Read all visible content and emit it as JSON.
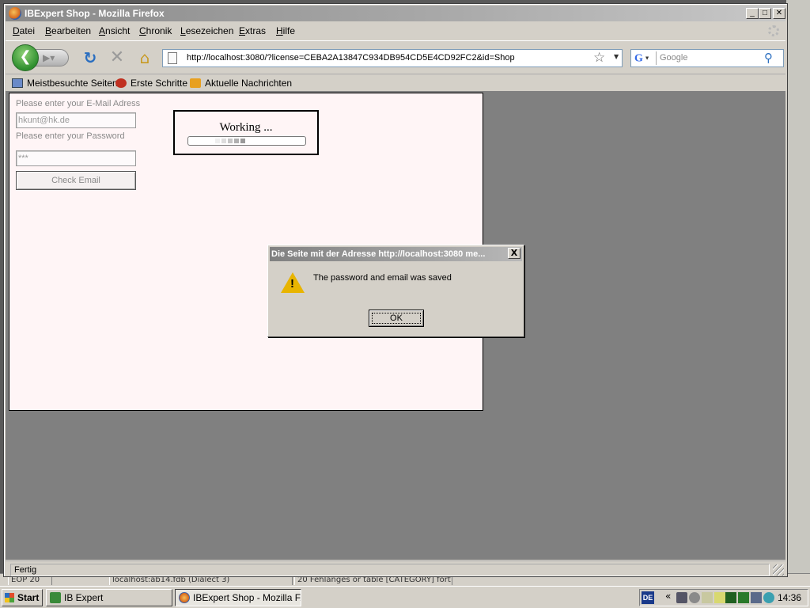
{
  "window": {
    "title": "IBExpert Shop - Mozilla Firefox",
    "min": "_",
    "max": "□",
    "close": "✕"
  },
  "menu": [
    "Datei",
    "Bearbeiten",
    "Ansicht",
    "Chronik",
    "Lesezeichen",
    "Extras",
    "Hilfe"
  ],
  "nav": {
    "url": "http://localhost:3080/?license=CEBA2A13847C934DB954CD5E4CD92FC2&id=Shop",
    "search_engine": "G",
    "search_placeholder": "Google"
  },
  "bookmarks": [
    "Meistbesuchte Seiten",
    "Erste Schritte",
    "Aktuelle Nachrichten"
  ],
  "form": {
    "email_label": "Please enter your E-Mail Adress",
    "email_value": "hkunt@hk.de",
    "password_label": "Please enter your Password",
    "password_value": "***",
    "check_button": "Check Email"
  },
  "working": {
    "text": "Working ..."
  },
  "status": "Fertig",
  "dialog": {
    "title": "Die Seite mit der Adresse http://localhost:3080 me...",
    "message": "The password and email was saved",
    "ok": "OK",
    "close": "X"
  },
  "background": {
    "left_cell": "EOP 20",
    "mid_cell": "localhost:ab14.fdb (Dialect 3)",
    "right_cell": "20 Fehlanges or table [CATEGORY] fort"
  },
  "taskbar": {
    "start": "Start",
    "tasks": [
      "IB Expert",
      "IBExpert Shop - Mozilla F..."
    ],
    "lang": "DE",
    "clock": "14:36"
  }
}
